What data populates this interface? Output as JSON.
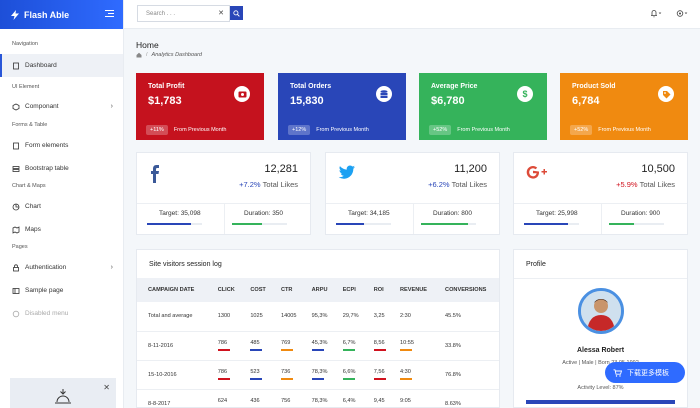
{
  "app": {
    "name": "Flash Able"
  },
  "sidebar": {
    "sections": [
      {
        "caption": "Navigation",
        "items": [
          {
            "label": "Dashboard"
          }
        ]
      },
      {
        "caption": "UI Element",
        "items": [
          {
            "label": "Componant"
          }
        ]
      },
      {
        "caption": "Forms & Table",
        "items": [
          {
            "label": "Form elements"
          },
          {
            "label": "Bootstrap table"
          }
        ]
      },
      {
        "caption": "Chart & Maps",
        "items": [
          {
            "label": "Chart"
          },
          {
            "label": "Maps"
          }
        ]
      },
      {
        "caption": "Pages",
        "items": [
          {
            "label": "Authentication"
          },
          {
            "label": "Sample page"
          },
          {
            "label": "Disabled menu"
          }
        ]
      }
    ]
  },
  "header": {
    "search_placeholder": "Search . . ."
  },
  "page": {
    "title": "Home",
    "breadcrumb": "Analytics Dashboard"
  },
  "stats": [
    {
      "label": "Total Profit",
      "value": "$1,783",
      "pct": "+11%",
      "note": "From Previous Month",
      "color": "#c5121e",
      "icon": "money-icon"
    },
    {
      "label": "Total Orders",
      "value": "15,830",
      "pct": "+12%",
      "note": "From Previous Month",
      "color": "#2946b8",
      "icon": "database-icon"
    },
    {
      "label": "Average Price",
      "value": "$6,780",
      "pct": "+52%",
      "note": "From Previous Month",
      "color": "#35b35b",
      "icon": "dollar-icon"
    },
    {
      "label": "Product Sold",
      "value": "6,784",
      "pct": "+52%",
      "note": "From Previous Month",
      "color": "#f08a10",
      "icon": "tag-icon"
    }
  ],
  "social": [
    {
      "network": "facebook",
      "count": "12,281",
      "change": "+7.2%",
      "change_color": "#2946b8",
      "likes": "Total Likes",
      "target_label": "Target:",
      "target": "35,098",
      "duration_label": "Duration:",
      "duration": "350",
      "target_fill": 0.8,
      "duration_fill": 0.55,
      "icon_color": "#3b5998"
    },
    {
      "network": "twitter",
      "count": "11,200",
      "change": "+6.2%",
      "change_color": "#2946b8",
      "likes": "Total Likes",
      "target_label": "Target:",
      "target": "34,185",
      "duration_label": "Duration:",
      "duration": "800",
      "target_fill": 0.5,
      "duration_fill": 0.85,
      "icon_color": "#1da1f2"
    },
    {
      "network": "google-plus",
      "count": "10,500",
      "change": "+5.9%",
      "change_color": "#d0121e",
      "likes": "Total Likes",
      "target_label": "Target:",
      "target": "25,998",
      "duration_label": "Duration:",
      "duration": "900",
      "target_fill": 0.8,
      "duration_fill": 0.45,
      "icon_color": "#dd4b39"
    }
  ],
  "session_log": {
    "title": "Site visitors session log",
    "columns": [
      "CAMPAIGN DATE",
      "CLICK",
      "COST",
      "CTR",
      "ARPU",
      "ECPI",
      "ROI",
      "REVENUE",
      "CONVERSIONS"
    ],
    "rows": [
      [
        "Total and average",
        "1300",
        "1025",
        "14005",
        "95,3%",
        "29,7%",
        "3,25",
        "2:30",
        "45.5%"
      ],
      [
        "8-11-2016",
        "786",
        "485",
        "769",
        "45,3%",
        "6,7%",
        "8,56",
        "10:55",
        "33.8%"
      ],
      [
        "15-10-2016",
        "786",
        "523",
        "736",
        "78,3%",
        "6,6%",
        "7,56",
        "4:30",
        "76.8%"
      ],
      [
        "8-8-2017",
        "624",
        "436",
        "756",
        "78,3%",
        "6,4%",
        "9,45",
        "9:05",
        "8.63%"
      ]
    ],
    "mini_colors": [
      "#d0121e",
      "#2946b8",
      "#f08a10",
      "#2946b8",
      "#35b35b",
      "#d0121e",
      "#f08a10",
      "#2946b8"
    ]
  },
  "profile": {
    "title": "Profile",
    "name": "Alessa Robert",
    "status": "Active | Male | Born 23.05.1992",
    "level": "Activity Level: 87%"
  },
  "download_button": {
    "label": "下载更多模板"
  }
}
